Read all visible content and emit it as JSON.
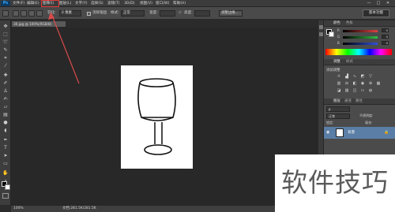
{
  "app": {
    "logo": "Ps",
    "menu": [
      "文件(F)",
      "编辑(E)",
      "图像(I)",
      "图层(L)",
      "文字(Y)",
      "选择(S)",
      "滤镜(T)",
      "3D(D)",
      "视图(V)",
      "窗口(W)",
      "帮助(H)"
    ],
    "highlighted_menu_index": 2,
    "window_buttons": [
      "—",
      "□",
      "✕"
    ]
  },
  "options": {
    "feather_label": "羽化:",
    "feather_value": "0 像素",
    "antialias_label": "消除锯齿",
    "style_label": "样式:",
    "style_value": "正常",
    "width_label": "宽度:",
    "height_label": "高度:",
    "refine_label": "调整边缘...",
    "workspace": "基本功能"
  },
  "document": {
    "tab_label": "30.jpg @ 100%(RGB/8)",
    "zoom": "100%",
    "status": "文档:281.5K/281.5K"
  },
  "panels": {
    "color_tabs": [
      "颜色",
      "色板"
    ],
    "channels": [
      {
        "name": "R",
        "value": "0",
        "color": "#e04040"
      },
      {
        "name": "G",
        "value": "0",
        "color": "#30c040"
      },
      {
        "name": "B",
        "value": "0",
        "color": "#3050e0"
      }
    ],
    "adjust_tabs": [
      "调整",
      "样式"
    ],
    "adjust_title": "添加调整",
    "layers_tabs": [
      "图层",
      "通道",
      "路径"
    ],
    "blend_mode": "正常",
    "opacity_label": "不透明度:",
    "lock_label": "锁定:",
    "fill_label": "填充:",
    "layer_name": "背景"
  },
  "watermark": "软件技巧",
  "colors": {
    "highlight": "#e03a3a",
    "arrow": "#d84a4a",
    "layer_selected": "#5a7ea6"
  }
}
